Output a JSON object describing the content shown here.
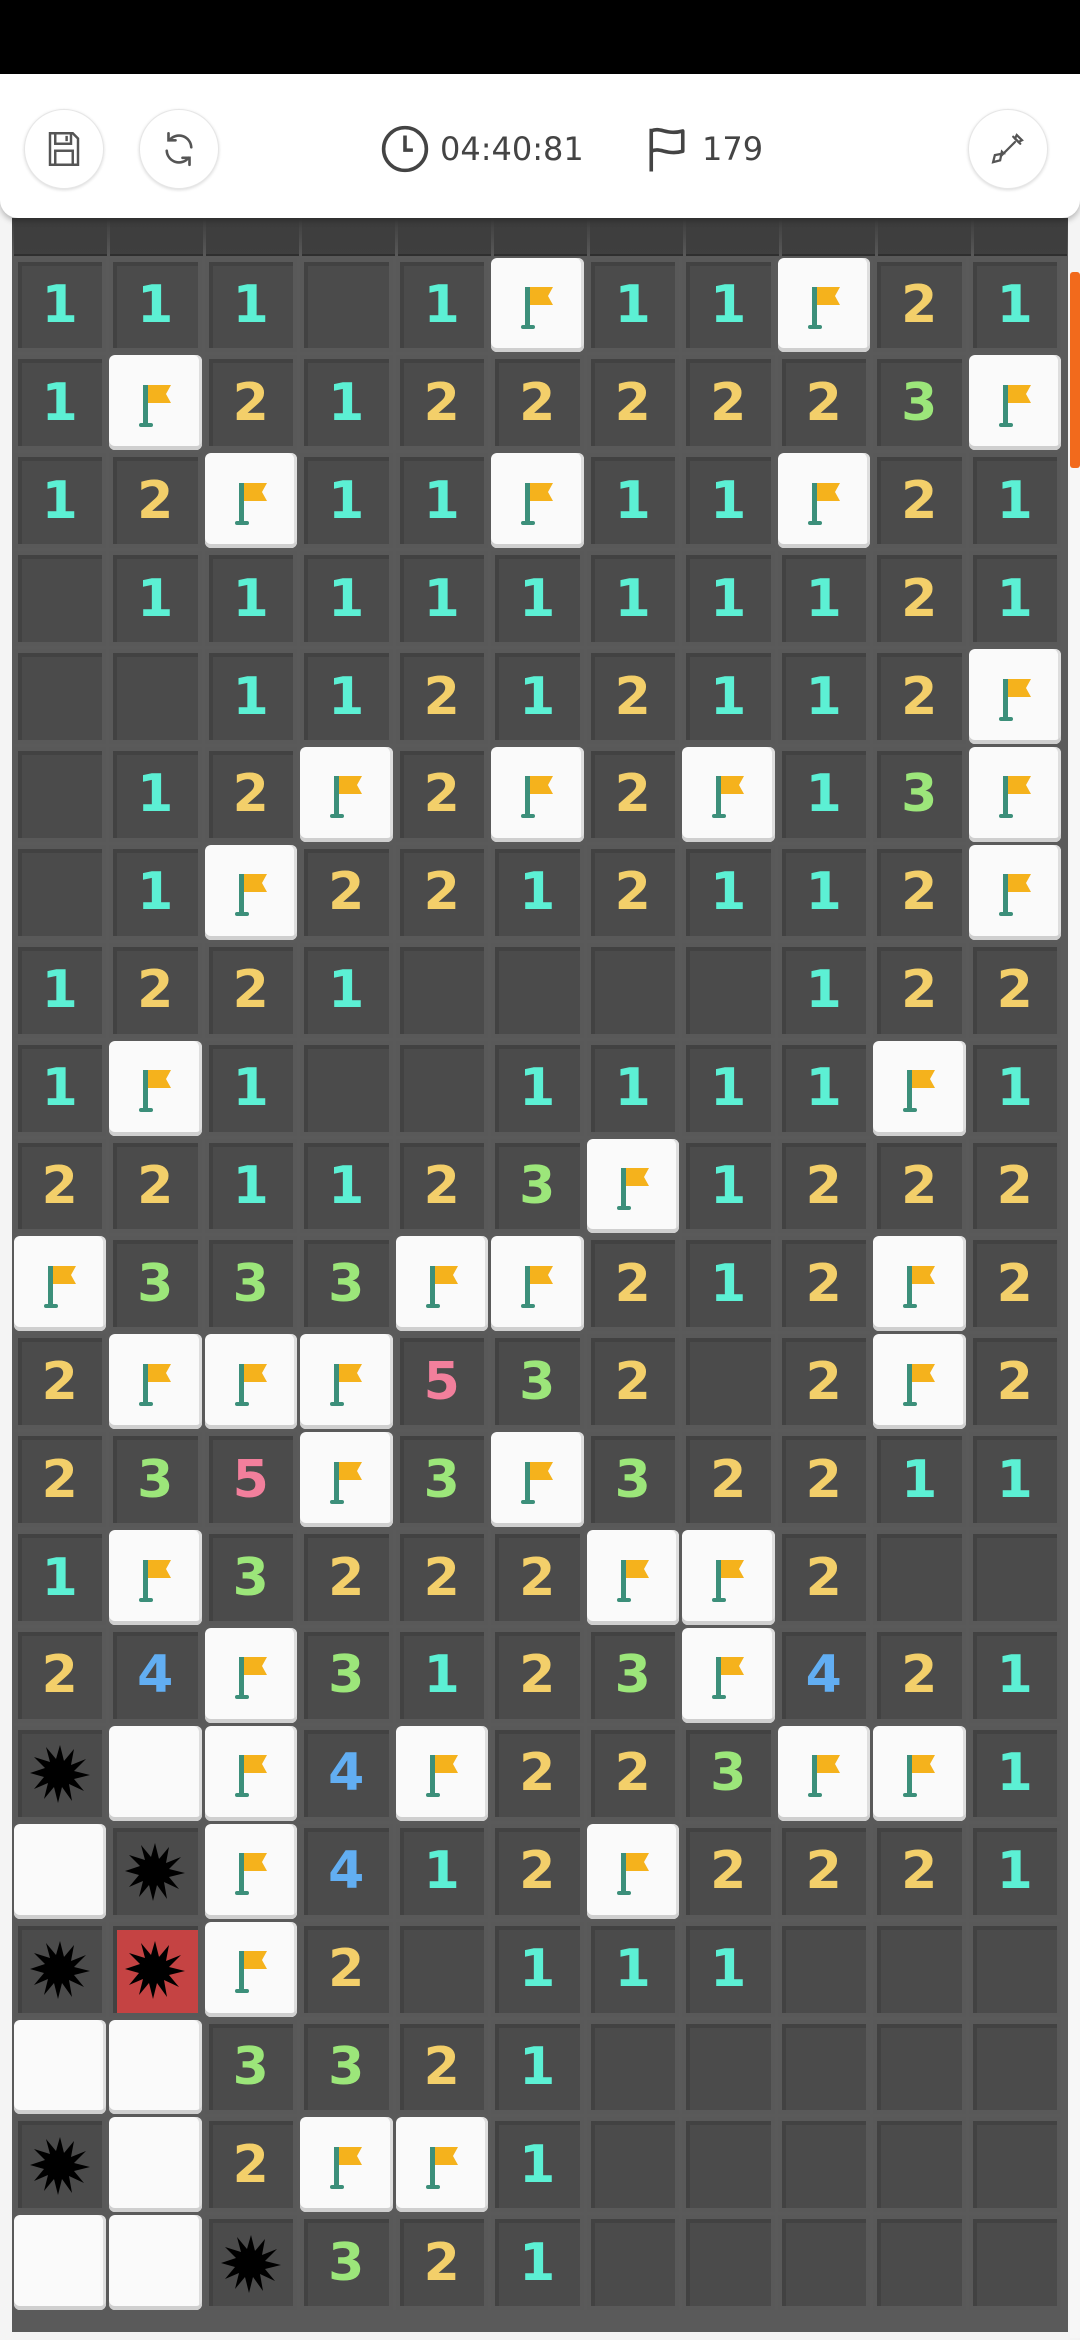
{
  "toolbar": {
    "save_icon": "save-icon",
    "restart_icon": "restart-icon",
    "timer_icon": "clock-icon",
    "timer": "04:40:81",
    "flags_icon": "flag-icon",
    "flags": "179",
    "tool_icon": "shovel-icon"
  },
  "colors": {
    "n1": "#5cf0d4",
    "n2": "#f3cf6a",
    "n3": "#9ce67a",
    "n4": "#62aef2",
    "n5": "#f27f9c",
    "flag": "#f5b21c",
    "exploded": "#c54343",
    "accent": "#f26a1c"
  },
  "board": {
    "cols": 11,
    "legend": "0=empty, 1-8=number, F=flag, M=mine, X=exploded mine, H=covered tile",
    "rows": [
      [
        "1",
        "1",
        "1",
        "0",
        "1",
        "F",
        "1",
        "1",
        "F",
        "2",
        "1"
      ],
      [
        "1",
        "F",
        "2",
        "1",
        "2",
        "2",
        "2",
        "2",
        "2",
        "3",
        "F"
      ],
      [
        "1",
        "2",
        "F",
        "1",
        "1",
        "F",
        "1",
        "1",
        "F",
        "2",
        "1"
      ],
      [
        "0",
        "1",
        "1",
        "1",
        "1",
        "1",
        "1",
        "1",
        "1",
        "2",
        "1"
      ],
      [
        "0",
        "0",
        "1",
        "1",
        "2",
        "1",
        "2",
        "1",
        "1",
        "2",
        "F"
      ],
      [
        "0",
        "1",
        "2",
        "F",
        "2",
        "F",
        "2",
        "F",
        "1",
        "3",
        "F"
      ],
      [
        "0",
        "1",
        "F",
        "2",
        "2",
        "1",
        "2",
        "1",
        "1",
        "2",
        "F"
      ],
      [
        "1",
        "2",
        "2",
        "1",
        "0",
        "0",
        "0",
        "0",
        "1",
        "2",
        "2"
      ],
      [
        "1",
        "F",
        "1",
        "0",
        "0",
        "1",
        "1",
        "1",
        "1",
        "F",
        "1"
      ],
      [
        "2",
        "2",
        "1",
        "1",
        "2",
        "3",
        "F",
        "1",
        "2",
        "2",
        "2"
      ],
      [
        "F",
        "3",
        "3",
        "3",
        "F",
        "F",
        "2",
        "1",
        "2",
        "F",
        "2"
      ],
      [
        "2",
        "F",
        "F",
        "F",
        "5",
        "3",
        "2",
        "0",
        "2",
        "F",
        "2"
      ],
      [
        "2",
        "3",
        "5",
        "F",
        "3",
        "F",
        "3",
        "2",
        "2",
        "1",
        "1"
      ],
      [
        "1",
        "F",
        "3",
        "2",
        "2",
        "2",
        "F",
        "F",
        "2",
        "0",
        "0"
      ],
      [
        "2",
        "4",
        "F",
        "3",
        "1",
        "2",
        "3",
        "F",
        "4",
        "2",
        "1"
      ],
      [
        "M",
        "H",
        "F",
        "4",
        "F",
        "2",
        "2",
        "3",
        "F",
        "F",
        "1"
      ],
      [
        "H",
        "M",
        "F",
        "4",
        "1",
        "2",
        "F",
        "2",
        "2",
        "2",
        "1"
      ],
      [
        "M",
        "X",
        "F",
        "2",
        "0",
        "1",
        "1",
        "1",
        "0",
        "0",
        "0"
      ],
      [
        "H",
        "H",
        "3",
        "3",
        "2",
        "1",
        "0",
        "0",
        "0",
        "0",
        "0"
      ],
      [
        "M",
        "H",
        "2",
        "F",
        "F",
        "1",
        "0",
        "0",
        "0",
        "0",
        "0"
      ],
      [
        "H",
        "H",
        "M",
        "3",
        "2",
        "1",
        "0",
        "0",
        "0",
        "0",
        "0"
      ]
    ]
  }
}
